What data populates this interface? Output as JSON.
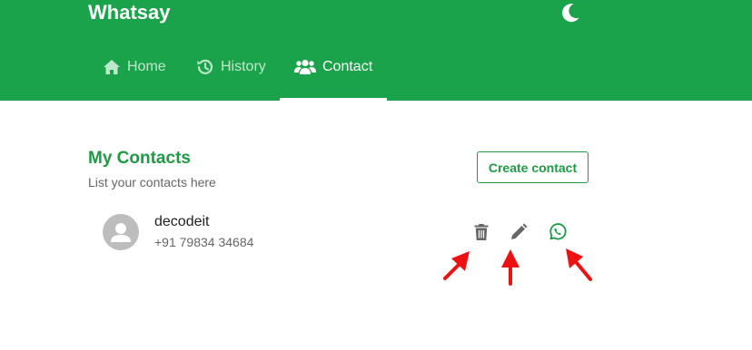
{
  "app": {
    "brand": "Whatsay"
  },
  "nav": {
    "tabs": [
      {
        "label": "Home",
        "icon": "home-icon"
      },
      {
        "label": "History",
        "icon": "history-icon"
      },
      {
        "label": "Contact",
        "icon": "contacts-icon",
        "active": true
      }
    ]
  },
  "contacts_section": {
    "title": "My Contacts",
    "subtitle": "List your contacts here",
    "create_label": "Create contact"
  },
  "contacts": [
    {
      "name": "decodeit",
      "phone": "+91 79834 34684"
    }
  ],
  "actions": [
    "trash-icon",
    "pencil-icon",
    "whatsapp-icon"
  ],
  "colors": {
    "header_bg": "#1aa34a",
    "accent": "#1f9a45",
    "annotation_arrow": "#ee1111"
  }
}
